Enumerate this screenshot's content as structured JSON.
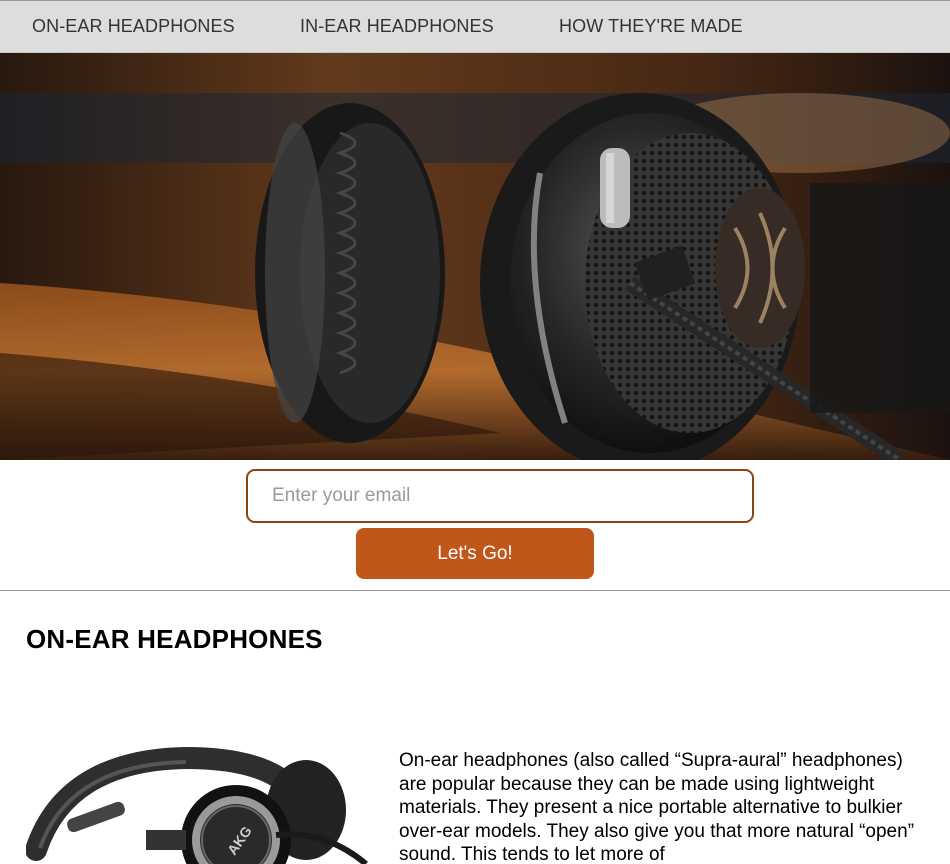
{
  "nav": {
    "links": [
      {
        "label": "ON-EAR HEADPHONES"
      },
      {
        "label": "IN-EAR HEADPHONES"
      },
      {
        "label": "HOW THEY'RE MADE"
      }
    ]
  },
  "signup": {
    "email_placeholder": "Enter your email",
    "email_value": "",
    "submit_label": "Let's Go!"
  },
  "section": {
    "title": "ON-EAR HEADPHONES",
    "image_brand": "AKG",
    "body": "On-ear headphones (also called “Supra-aural” headphones) are popular because they can be made using lightweight materials. They present a nice portable alternative to bulkier over-ear models. They also give you that more natural “open” sound. This tends to let more of"
  },
  "colors": {
    "accent": "#c0561a",
    "input_border": "#8b4513",
    "nav_background": "#dddddd"
  }
}
